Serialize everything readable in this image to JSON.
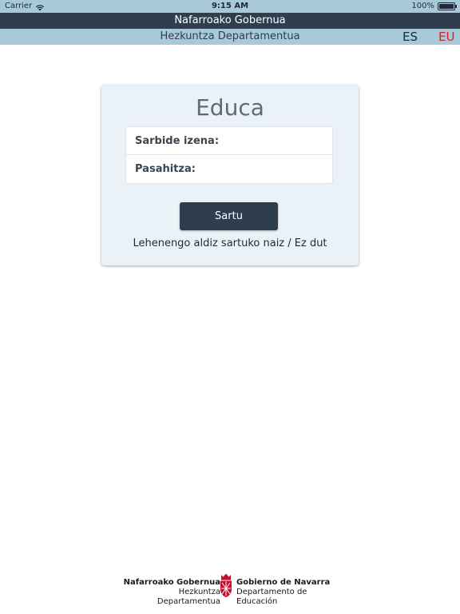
{
  "status_bar": {
    "carrier": "Carrier",
    "time": "9:15 AM",
    "battery": "100%",
    "battery_level_pct": 100,
    "icons": [
      "wifi-icon",
      "battery-icon"
    ]
  },
  "header": {
    "government": "Nafarroako Gobernua",
    "department": "Hezkuntza Departamentua",
    "languages": [
      {
        "code": "ES",
        "selected": false
      },
      {
        "code": "EU",
        "selected": true
      }
    ]
  },
  "login": {
    "title": "Educa",
    "username_label": "Sarbide izena:",
    "username_value": "",
    "password_label": "Pasahitza:",
    "password_value": "",
    "submit_label": "Sartu",
    "first_time_link": "Lehenengo aldiz sartuko naiz / Ez dut"
  },
  "footer": {
    "left_line1": "Nafarroako Gobernua",
    "left_line2": "Hezkuntza Departamentua",
    "right_line1": "Gobierno de Navarra",
    "right_line2": "Departamento de Educación",
    "crest_icon": "navarra-crest-icon"
  },
  "colors": {
    "status_bar_bg": "#a7c9da",
    "header_dark": "#2f3e4e",
    "card_bg": "#eaf2f7",
    "selected_lang": "#e02020",
    "crest_red": "#c8102e"
  }
}
